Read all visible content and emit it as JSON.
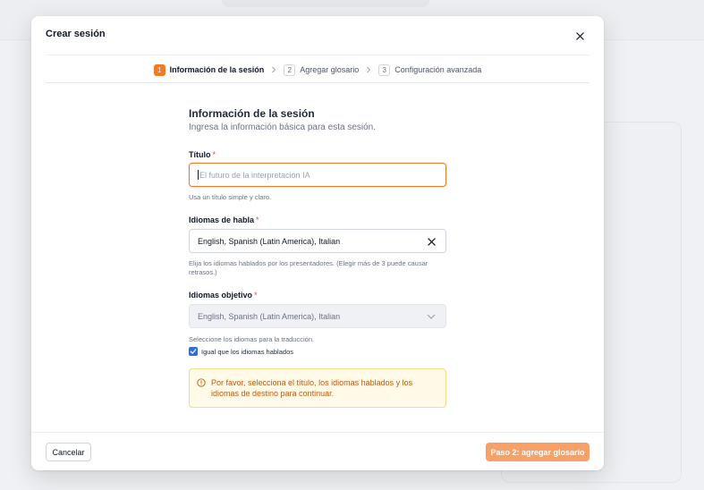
{
  "modal": {
    "title": "Crear sesión"
  },
  "stepper": {
    "steps": [
      {
        "number": "1",
        "label": "Información de la sesión"
      },
      {
        "number": "2",
        "label": "Agregar glosario"
      },
      {
        "number": "3",
        "label": "Configuración avanzada"
      }
    ]
  },
  "form": {
    "section_title": "Información de la sesión",
    "section_subtitle": "Ingresa la información básica para esta sesión.",
    "title_field": {
      "label": "Título",
      "required_mark": "*",
      "placeholder": "El futuro de la interpretación IA",
      "value": "",
      "help": "Usa un título simple y claro."
    },
    "spoken_languages": {
      "label": "Idiomas de habla",
      "required_mark": "*",
      "value": "English, Spanish (Latin America), Italian",
      "help": "Elija los idiomas hablados por los presentadores. (Elegir más de 3 puede causar retrasos.)"
    },
    "target_languages": {
      "label": "Idiomas objetivo",
      "required_mark": "*",
      "value": "English, Spanish (Latin America), Italian",
      "help": "Seleccione los idiomas para la traducción."
    },
    "same_as_spoken": {
      "label": "Igual que los idiomas hablados",
      "checked": true
    },
    "alert": {
      "text": "Por favor, selecciona el título, los idiomas hablados y los idiomas de destino para continuar."
    }
  },
  "footer": {
    "cancel_label": "Cancelar",
    "next_label": "Paso 2: agregar glosario"
  },
  "colors": {
    "accent": "#f27a24",
    "accent_disabled": "#f7a067",
    "checkbox": "#2f6fdc",
    "alert_bg": "#fffbe8",
    "alert_border": "#f5dd85",
    "alert_text": "#c2590e",
    "required": "#ef4444"
  }
}
